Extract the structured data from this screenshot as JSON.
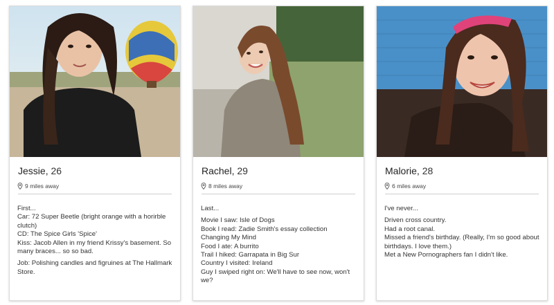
{
  "cards": [
    {
      "name": "Jessie",
      "age": "26",
      "distance": "9 miles away",
      "bio_heading": "First...",
      "bio_lines": [
        "Car: 72 Super Beetle (bright orange with a horirble clutch)",
        "CD: The Spice Girls 'Spice'",
        "Kiss: Jacob Allen in my friend Krissy's basement. So many braces... so so bad."
      ],
      "bio_footer": "Job: Polishing candles and figruines at The Hallmark Store."
    },
    {
      "name": "Rachel",
      "age": "29",
      "distance": "8 miles away",
      "bio_heading": "Last...",
      "bio_lines": [
        "Movie I saw: Isle of Dogs",
        "Book I read: Zadie Smith's essay collection Changing My Mind",
        "Food I ate: A burrito",
        "Trail I hiked: Garrapata in Big Sur",
        "Country I visited: Ireland",
        "Guy I swiped right on: We'll have to see now, won't we?"
      ]
    },
    {
      "name": "Malorie",
      "age": "28",
      "distance": "6 miles away",
      "bio_heading": "I've never...",
      "bio_lines": [
        "Driven cross country.",
        "Had a root canal.",
        "Missed a friend's birthday. (Really, I'm so good about birthdays. I love them.)",
        "Met a New Pornographers fan I didn't like."
      ]
    }
  ],
  "colors": {
    "card_border": "#dcdcdc",
    "divider": "#cfcfcf",
    "text": "#333333"
  }
}
